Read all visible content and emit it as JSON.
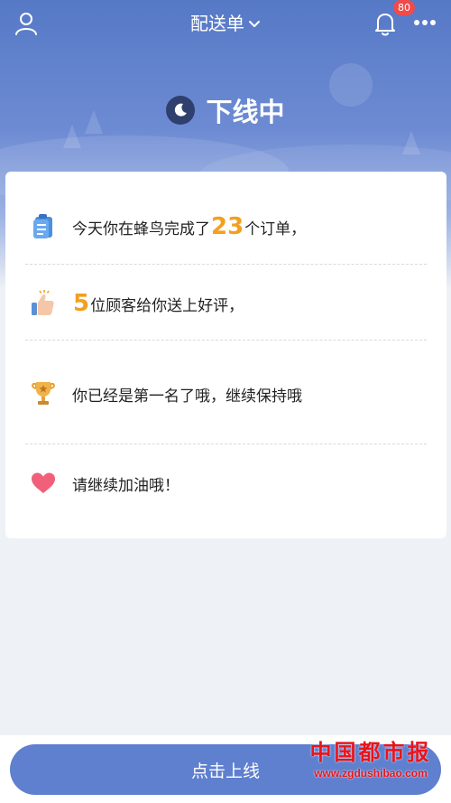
{
  "header": {
    "title": "配送单",
    "badge_count": "80"
  },
  "status": {
    "label": "下线中"
  },
  "summary": {
    "rows": [
      {
        "icon": "clipboard-icon",
        "prefix": "今天你在蜂鸟完成了",
        "number": "23",
        "suffix": "个订单，"
      },
      {
        "icon": "thumbs-up-icon",
        "prefix": "",
        "number": "5",
        "suffix": "位顾客给你送上好评，"
      },
      {
        "icon": "trophy-icon",
        "prefix": "你已经是第一名了哦，继续保持哦",
        "number": "",
        "suffix": ""
      },
      {
        "icon": "heart-icon",
        "prefix": "请继续加油哦！",
        "number": "",
        "suffix": ""
      }
    ]
  },
  "footer": {
    "go_online_label": "点击上线"
  },
  "watermark": {
    "name": "中国都市报",
    "url": "www.zgdushibao.com"
  },
  "colors": {
    "header_blue": "#5679c6",
    "highlight_orange": "#f2a020",
    "button_blue": "#5f7fcf",
    "badge_red": "#f04a4a",
    "watermark_red": "#e8141b"
  }
}
